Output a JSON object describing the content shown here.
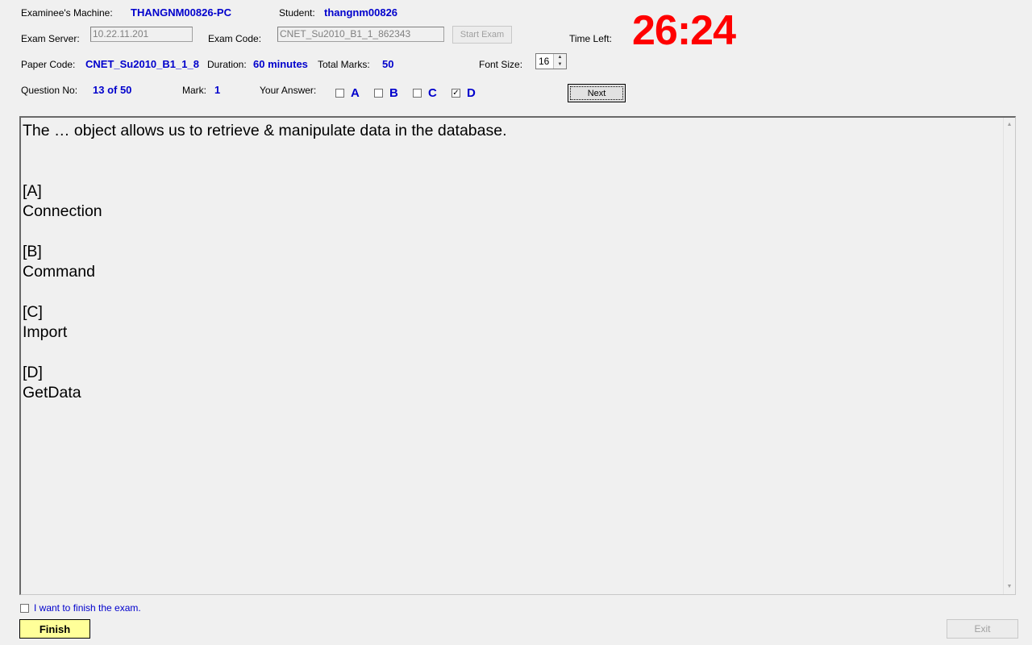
{
  "header": {
    "examinee_machine_label": "Examinee's Machine:",
    "examinee_machine_value": "THANGNM00826-PC",
    "student_label": "Student:",
    "student_value": "thangnm00826",
    "exam_server_label": "Exam Server:",
    "exam_server_value": "10.22.11.201",
    "exam_code_label": "Exam Code:",
    "exam_code_value": "CNET_Su2010_B1_1_862343",
    "start_exam_label": "Start Exam",
    "time_left_label": "Time Left:",
    "time_left_value": "26:24",
    "paper_code_label": "Paper Code:",
    "paper_code_value": "CNET_Su2010_B1_1_8",
    "duration_label": "Duration:",
    "duration_value": "60 minutes",
    "total_marks_label": "Total Marks:",
    "total_marks_value": "50",
    "font_size_label": "Font Size:",
    "font_size_value": "16",
    "question_no_label": "Question No:",
    "question_no_value": "13 of 50",
    "mark_label": "Mark:",
    "mark_value": "1",
    "your_answer_label": "Your Answer:",
    "next_label": "Next"
  },
  "answers": [
    {
      "letter": "A",
      "checked": false,
      "mark": ""
    },
    {
      "letter": "B",
      "checked": false,
      "mark": ""
    },
    {
      "letter": "C",
      "checked": false,
      "mark": ""
    },
    {
      "letter": "D",
      "checked": true,
      "mark": "✓"
    }
  ],
  "question": {
    "text": "The … object allows us to retrieve & manipulate data in the database.\n\n\n[A]\nConnection\n\n[B]\nCommand\n\n[C]\nImport\n\n[D]\nGetData"
  },
  "footer": {
    "finish_checkbox_label": "I want to finish the exam.",
    "finish_label": "Finish",
    "exit_label": "Exit"
  },
  "colors": {
    "background": "#f0f0f0",
    "value_blue": "#0000cc",
    "timer_red": "#ff0000",
    "finish_yellow": "#ffff99"
  },
  "icons": {
    "spin_up": "spin-up-icon",
    "spin_down": "spin-down-icon",
    "scroll_up": "scroll-up-arrow-icon",
    "scroll_down": "scroll-down-arrow-icon"
  }
}
